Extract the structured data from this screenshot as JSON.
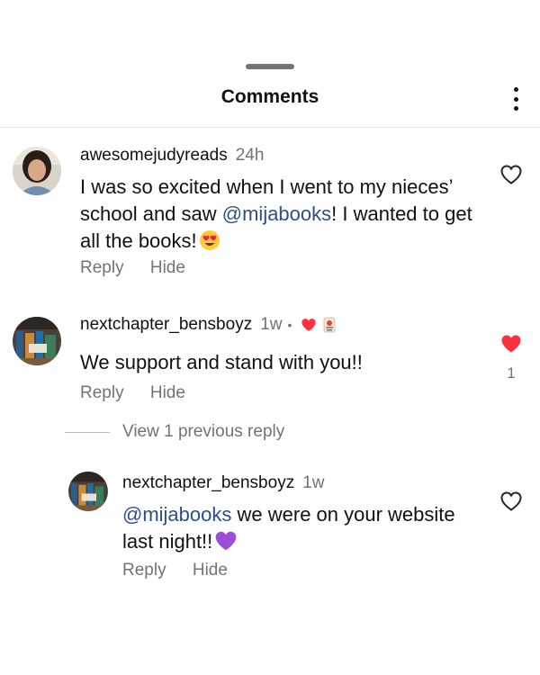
{
  "header": {
    "title": "Comments"
  },
  "comments": [
    {
      "username": "awesomejudyreads",
      "time": "24h",
      "text_before": "I was so excited when I went to my nieces’ school and saw ",
      "mention": "@mijabooks",
      "text_after": "! I wanted to get all the books!",
      "emoji": "smiling-face-with-heart-eyes",
      "reply_label": "Reply",
      "hide_label": "Hide",
      "liked": false
    },
    {
      "username": "nextchapter_bensboyz",
      "time": "1w",
      "separator": "•",
      "text": "We support and stand with you!!",
      "reply_label": "Reply",
      "hide_label": "Hide",
      "liked": true,
      "like_count": "1"
    }
  ],
  "view_replies": {
    "label": "View 1 previous reply"
  },
  "reply": {
    "username": "nextchapter_bensboyz",
    "time": "1w",
    "mention": "@mijabooks",
    "text_line1": " we were on your website",
    "text_line2": "last night!!",
    "emoji": "purple-heart",
    "reply_label": "Reply",
    "hide_label": "Hide",
    "liked": false
  },
  "colors": {
    "like_red": "#ff3040",
    "mention": "#2d4d8c",
    "secondary_text": "#737373",
    "purple_heart": "#9c4fd6"
  }
}
